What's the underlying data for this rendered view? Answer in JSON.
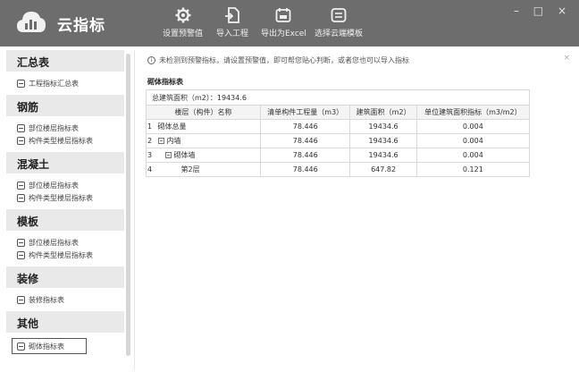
{
  "app": {
    "title": "云指标"
  },
  "toolbar": [
    {
      "label": "设置预警值",
      "icon": "gear-icon"
    },
    {
      "label": "导入工程",
      "icon": "import-icon"
    },
    {
      "label": "导出为Excel",
      "icon": "export-excel-icon"
    },
    {
      "label": "选择云端模板",
      "icon": "cloud-template-icon"
    }
  ],
  "window_controls": {
    "minimize": "–",
    "maximize": "□",
    "close": "×"
  },
  "sidebar": [
    {
      "title": "汇总表",
      "items": [
        "工程指标汇总表"
      ]
    },
    {
      "title": "钢筋",
      "items": [
        "部位楼层指标表",
        "构件类型楼层指标表"
      ]
    },
    {
      "title": "混凝土",
      "items": [
        "部位楼层指标表",
        "构件类型楼层指标表"
      ]
    },
    {
      "title": "模板",
      "items": [
        "部位楼层指标表",
        "构件类型楼层指标表"
      ]
    },
    {
      "title": "装修",
      "items": [
        "装修指标表"
      ]
    },
    {
      "title": "其他",
      "items": [
        "砌体指标表"
      ]
    }
  ],
  "notice": {
    "text": "未检测到预警指标，请设置预警值，即可帮您贴心判断，或者您也可以导入指标",
    "close": "×"
  },
  "table": {
    "title": "砌体指标表",
    "total_label": "总建筑面积（m2）：19434.6",
    "headers": [
      "楼层（构件）名称",
      "清单构件工程量（m3）",
      "建筑面积（m2）",
      "单位建筑面积指标（m3/m2）"
    ],
    "rows": [
      {
        "no": "1",
        "name": "砌体总量",
        "qty": "78.446",
        "area": "19434.6",
        "index": "0.004"
      },
      {
        "no": "2",
        "name": "内墙",
        "qty": "78.446",
        "area": "19434.6",
        "index": "0.004"
      },
      {
        "no": "3",
        "name": "砌体墙",
        "qty": "78.446",
        "area": "19434.6",
        "index": "0.004"
      },
      {
        "no": "4",
        "name": "第2层",
        "qty": "78.446",
        "area": "647.82",
        "index": "0.121"
      }
    ]
  }
}
